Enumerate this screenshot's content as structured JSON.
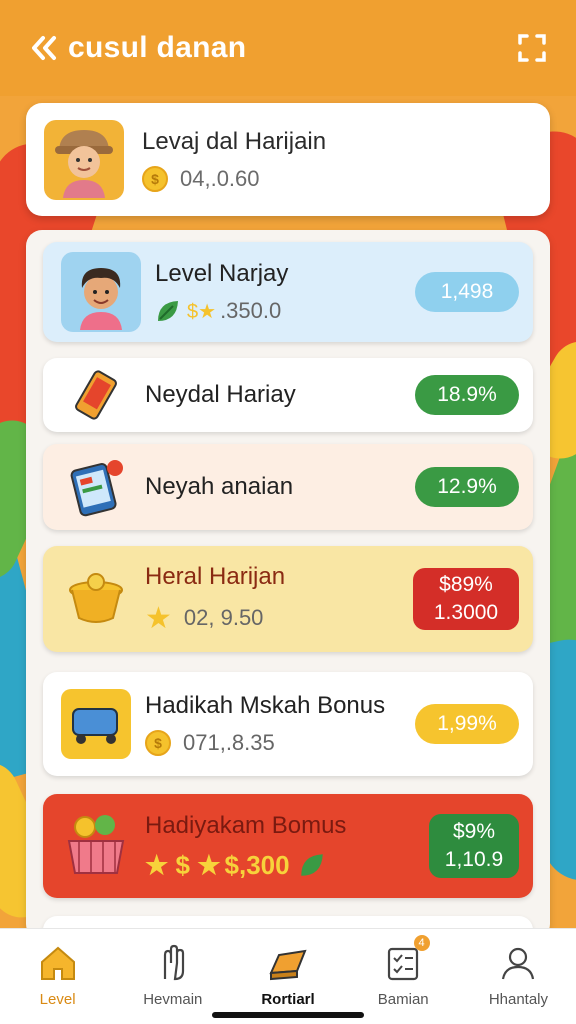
{
  "colors": {
    "accent": "#f0a030",
    "green": "#3a9a44",
    "red": "#d42e28",
    "blue": "#8fd0ee"
  },
  "header": {
    "title": "cusul danan",
    "back_icon": "double-chevron-left-icon",
    "expand_icon": "expand-icon"
  },
  "profile": {
    "title": "Levaj dal Harijain",
    "value": "04,.0.60",
    "coin_icon": "coin-icon"
  },
  "rows": [
    {
      "title": "Level Narjay",
      "value": ".350.0",
      "badge": "1,498",
      "icon": "boy-avatar-icon"
    },
    {
      "title": "Neydal Hariay",
      "badge": "18.9%",
      "icon": "phone-icon"
    },
    {
      "title": "Neyah anaian",
      "badge": "12.9%",
      "icon": "tablet-icon"
    },
    {
      "title": "Heral Harijan",
      "value": "02, 9.50",
      "badge_line1": "$89%",
      "badge_line2": "1.3000",
      "icon": "basket-icon"
    },
    {
      "title": "Hadikah Mskah Bonus",
      "value": "071,.8.35",
      "badge": "1,99%",
      "icon": "cart-icon"
    },
    {
      "title": "Hadiyakam Bomus",
      "value": "$,300",
      "badge_line1": "$9%",
      "badge_line2": "1,10.9",
      "icon": "gift-basket-icon"
    }
  ],
  "nav": [
    {
      "label": "Level",
      "icon": "home-icon"
    },
    {
      "label": "Hevmain",
      "icon": "hand-icon"
    },
    {
      "label": "Rortiarl",
      "icon": "gold-bar-icon"
    },
    {
      "label": "Bamian",
      "icon": "checklist-icon",
      "badge": "4"
    },
    {
      "label": "Hhantaly",
      "icon": "person-icon"
    }
  ]
}
